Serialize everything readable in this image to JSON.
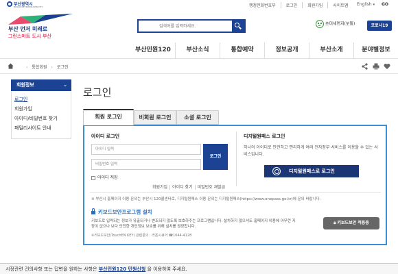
{
  "top": {
    "brand": "부산광역시",
    "brand_sub": "BUSAN METROPOLITAN CITY",
    "links": [
      "행정전화번호부",
      "로그인",
      "회원가입",
      "사이트맵"
    ],
    "language": "English",
    "go_label": "GO"
  },
  "header": {
    "logo_line1": "부산 먼저 미래로",
    "logo_line2": "그린스마트 도시 부산",
    "search_placeholder": "검색어를 입력하세요.",
    "weather_text": "초미세먼지(보통)",
    "corona_label": "코로나19"
  },
  "gnb": [
    "부산민원120",
    "부산소식",
    "통합예약",
    "정보공개",
    "부산소개",
    "분야별정보"
  ],
  "breadcrumb": [
    "통합회원",
    "로그인"
  ],
  "sidebar": {
    "title": "회원정보",
    "items": [
      "로그인",
      "회원가입",
      "아이디/비밀번호 찾기",
      "패밀리사이트 안내"
    ]
  },
  "main": {
    "title": "로그인",
    "tabs": [
      "회원 로그인",
      "비회원 로그인",
      "소셜 로그인"
    ],
    "id_login": {
      "title": "아이디 로그인",
      "id_placeholder": "아이디 입력",
      "pw_placeholder": "비밀번호 입력",
      "login_button": "로그인",
      "save_id": "아이디 저장",
      "links": [
        "회원가입",
        "아이디 찾기",
        "비밀번호 재발급"
      ]
    },
    "digital": {
      "title": "디지털원패스 로그인",
      "desc": "하나의 아이디로 안전하고 편리하게 여러 전자정부 서비스를 이용할 수 있는 서비스입니다.",
      "button": "디지털원패스로 로그인"
    },
    "notice": "※ 부산시 홈페이지 이용 문의는 부산시 120콜센터로, 디지털원패스 이용 문의는 디지털원패스(https://www.onepass.go.kr)에 문의 바랍니다.",
    "keyboard": {
      "title": "키보드보안프로그램 설치",
      "desc": "키보드로 입력되는 정보가 유출되거나 변조되지 않도록 보호하주는 프로그램입니다. 설치하지 않으셔도 홈페이지 이용에 아무런 지장이 없으나 보다 안전한 개인정보 보호를 위해 설치를 권장합니다.",
      "contact": "※키보드보안(TouchEN KEY) 관련문의 : 라온시큐어 ☎1644-4128",
      "button": "키보드보안 적용중"
    }
  },
  "footer": {
    "text_before": "시정관련 건의사항 또는 답변을 원하는 사항은 ",
    "link": "부산민원120 민원신청",
    "text_after": " 을 이용하여 주세요."
  },
  "colors": {
    "primary": "#1c4393",
    "panel_border": "#3a8fd6",
    "digital_btn": "#1c3575",
    "accent_pink": "#e74c6f"
  }
}
